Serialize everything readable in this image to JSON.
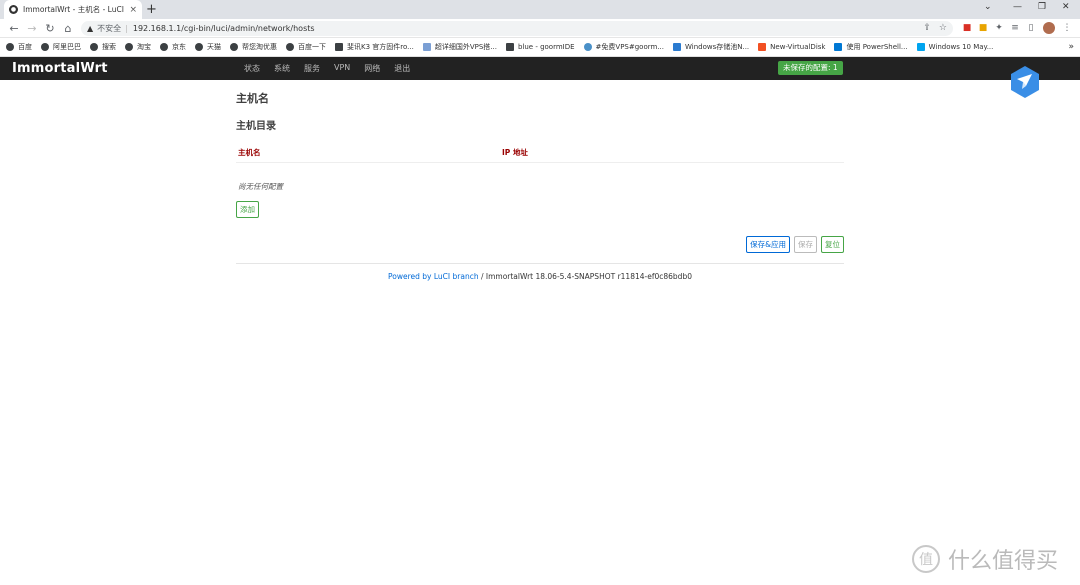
{
  "browser": {
    "tab_title": "ImmortalWrt - 主机名 - LuCI",
    "url_warning": "不安全",
    "url": "192.168.1.1/cgi-bin/luci/admin/network/hosts",
    "bookmarks": [
      "百度",
      "阿里巴巴",
      "搜索",
      "淘宝",
      "京东",
      "天猫",
      "帮您淘优惠",
      "百度一下",
      "斐讯K3 官方固件ro...",
      "超详细国外VPS搭...",
      "blue - goormIDE",
      "#免费VPS#goorm...",
      "Windows存储池N...",
      "New-VirtualDisk",
      "使用 PowerShell...",
      "Windows 10 May..."
    ]
  },
  "app": {
    "brand": "ImmortalWrt",
    "menu": [
      "状态",
      "系统",
      "服务",
      "VPN",
      "网络",
      "退出"
    ],
    "unsaved_badge": "未保存的配置: 1"
  },
  "page": {
    "title": "主机名",
    "section_title": "主机目录",
    "columns": [
      "主机名",
      "IP 地址"
    ],
    "empty_text": "尚无任何配置",
    "add_button": "添加",
    "apply_button": "保存&应用",
    "save_button": "保存",
    "reset_button": "复位"
  },
  "footer": {
    "link_text": "Powered by LuCI branch",
    "version": " / ImmortalWrt 18.06-5.4-SNAPSHOT r11814-ef0c86bdb0"
  },
  "watermark": {
    "badge": "值",
    "text": "什么值得买"
  },
  "colors": {
    "header_bg": "#222222",
    "success": "#46a546",
    "primary": "#0069d6",
    "column_header": "#990000"
  }
}
